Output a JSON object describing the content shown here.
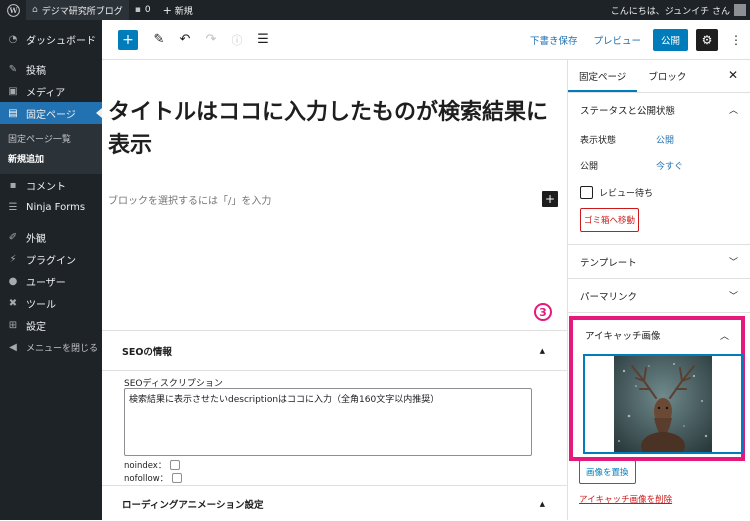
{
  "admin_bar": {
    "site_name": "デジマ研究所ブログ",
    "comments_count": "0",
    "new_label": "新規",
    "greeting": "こんにちは、ジュンイチ さん"
  },
  "sidebar": {
    "items": [
      {
        "label": "ダッシュボード",
        "icon": "dashboard-icon"
      },
      {
        "label": "投稿",
        "icon": "pin-icon"
      },
      {
        "label": "メディア",
        "icon": "media-icon"
      },
      {
        "label": "固定ページ",
        "icon": "page-icon"
      },
      {
        "label": "コメント",
        "icon": "comment-icon"
      },
      {
        "label": "Ninja Forms",
        "icon": "form-icon"
      },
      {
        "label": "外観",
        "icon": "brush-icon"
      },
      {
        "label": "プラグイン",
        "icon": "plugin-icon"
      },
      {
        "label": "ユーザー",
        "icon": "user-icon"
      },
      {
        "label": "ツール",
        "icon": "wrench-icon"
      },
      {
        "label": "設定",
        "icon": "settings-icon"
      },
      {
        "label": "メニューを閉じる",
        "icon": "collapse-icon"
      }
    ],
    "submenu": [
      "固定ページ一覧",
      "新規追加"
    ]
  },
  "toolbar": {
    "save_draft": "下書き保存",
    "preview": "プレビュー",
    "publish": "公開"
  },
  "editor": {
    "title": "タイトルはココに入力したものが検索結果に表示",
    "block_placeholder": "ブロックを選択するには「/」を入力"
  },
  "meta": {
    "seo_heading": "SEOの情報",
    "seo_desc_label": "SEOディスクリプション",
    "seo_desc_value": "検索結果に表示させたいdescriptionはココに入力（全角160文字以内推奨）",
    "noindex_label": "noindex：",
    "nofollow_label": "nofollow：",
    "loading_heading": "ローディングアニメーション設定"
  },
  "settings": {
    "tab_page": "固定ページ",
    "tab_block": "ブロック",
    "status_heading": "ステータスと公開状態",
    "visibility_label": "表示状態",
    "visibility_value": "公開",
    "publish_label": "公開",
    "publish_value": "今すぐ",
    "pending_review": "レビュー待ち",
    "trash_button": "ゴミ箱へ移動",
    "template_heading": "テンプレート",
    "permalink_heading": "パーマリンク",
    "featured_heading": "アイキャッチ画像",
    "replace_button": "画像を置換",
    "remove_link": "アイキャッチ画像を削除"
  },
  "annotation": {
    "step_number": "3"
  },
  "colors": {
    "admin_dark": "#1d2327",
    "accent_blue": "#007cba",
    "annotation_pink": "#e5197c",
    "danger_red": "#cc1818"
  }
}
